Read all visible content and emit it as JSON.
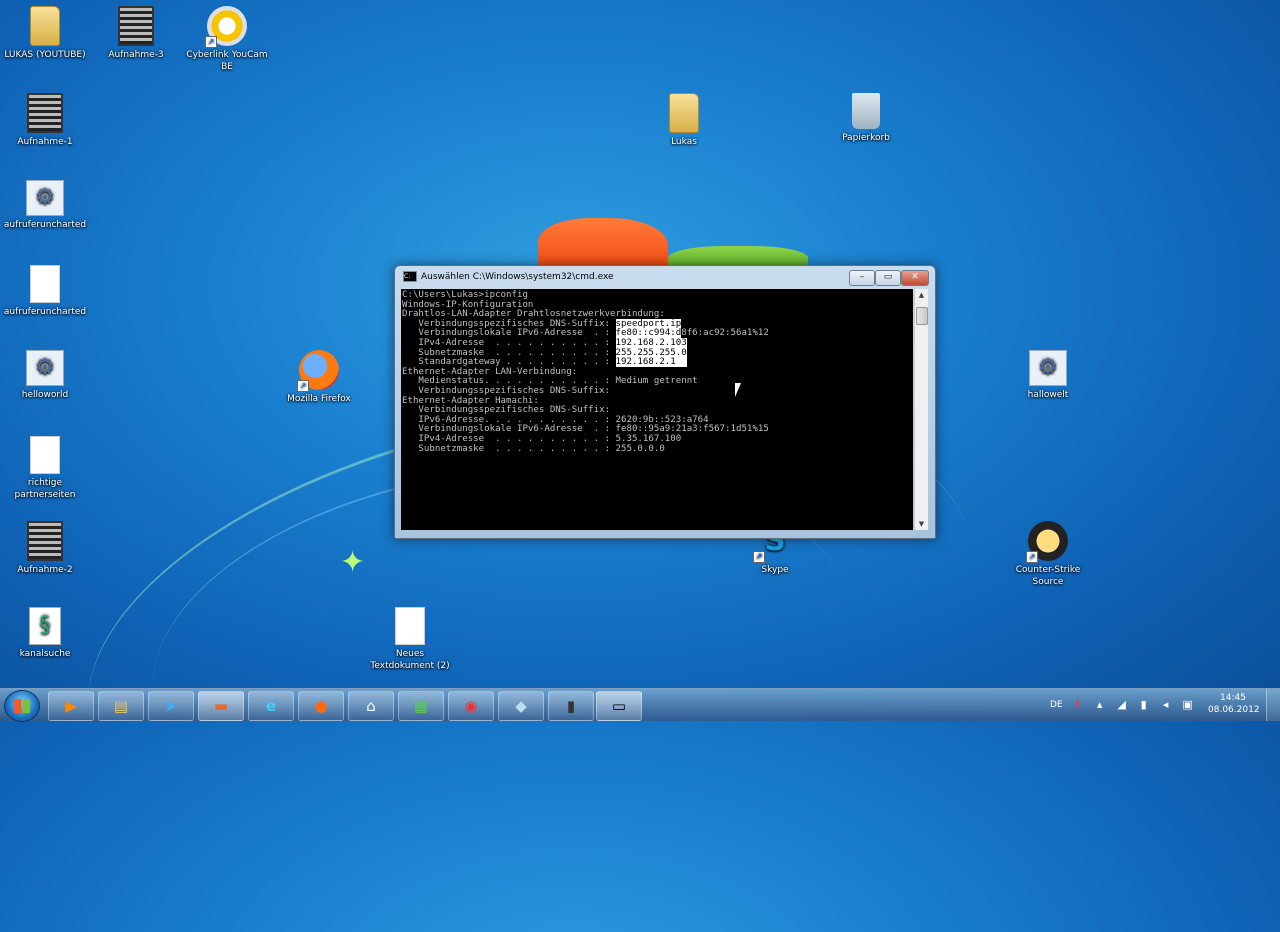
{
  "desktop": {
    "icons": [
      {
        "key": "lukas_youtube",
        "label": "LUKAS (YOUTUBE)",
        "icon": "folder-icon"
      },
      {
        "key": "aufnahme3",
        "label": "Aufnahme-3",
        "icon": "video-file-icon"
      },
      {
        "key": "cyberlink",
        "label": "Cyberlink YouCam BE",
        "icon": "webcam-icon"
      },
      {
        "key": "aufnahme1",
        "label": "Aufnahme-1",
        "icon": "video-file-icon"
      },
      {
        "key": "aufruferuncharted1",
        "label": "aufruferuncharted",
        "icon": "batch-file-icon"
      },
      {
        "key": "aufruferuncharted2",
        "label": "aufruferuncharted",
        "icon": "text-file-icon"
      },
      {
        "key": "helloworld",
        "label": "helloworld",
        "icon": "batch-file-icon"
      },
      {
        "key": "richtige",
        "label": "richtige partnerseiten",
        "icon": "text-file-icon"
      },
      {
        "key": "aufnahme2",
        "label": "Aufnahme-2",
        "icon": "video-file-icon"
      },
      {
        "key": "kanalsuche",
        "label": "kanalsuche",
        "icon": "script-file-icon"
      },
      {
        "key": "firefox",
        "label": "Mozilla Firefox",
        "icon": "firefox-icon"
      },
      {
        "key": "neues",
        "label": "Neues Textdokument (2)",
        "icon": "text-file-icon"
      },
      {
        "key": "lukas",
        "label": "Lukas",
        "icon": "folder-icon"
      },
      {
        "key": "papierkorb",
        "label": "Papierkorb",
        "icon": "recycle-bin-icon"
      },
      {
        "key": "skype",
        "label": "Skype",
        "icon": "skype-icon"
      },
      {
        "key": "hallowelt",
        "label": "hallowelt",
        "icon": "batch-file-icon"
      },
      {
        "key": "counterstrike",
        "label": "Counter-Strike Source",
        "icon": "counter-strike-icon"
      }
    ]
  },
  "cmd": {
    "title": "Auswählen C:\\Windows\\system32\\cmd.exe",
    "buttons": {
      "minimize": "–",
      "maximize": "▭",
      "close": "✕"
    },
    "lines": [
      "C:\\Users\\Lukas>ipconfig",
      "",
      "Windows-IP-Konfiguration",
      "",
      "",
      "Drahtlos-LAN-Adapter Drahtlosnetzwerkverbindung:",
      "",
      "   Verbindungsspezifisches DNS-Suffix: ",
      "   Verbindungslokale IPv6-Adresse  . : ",
      "   IPv4-Adresse  . . . . . . . . . . : ",
      "   Subnetzmaske  . . . . . . . . . . : ",
      "   Standardgateway . . . . . . . . . : ",
      "",
      "Ethernet-Adapter LAN-Verbindung:",
      "",
      "   Medienstatus. . . . . . . . . . . : Medium getrennt",
      "   Verbindungsspezifisches DNS-Suffix:",
      "",
      "Ethernet-Adapter Hamachi:",
      "",
      "   Verbindungsspezifisches DNS-Suffix:",
      "   IPv6-Adresse. . . . . . . . . . . : 2620:9b::523:a764",
      "   Verbindungslokale IPv6-Adresse  . : fe80::95a9:21a3:f567:1d51%15",
      "   IPv4-Adresse  . . . . . . . . . . : 5.35.167.100",
      "   Subnetzmaske  . . . . . . . . . . : 255.0.0.0"
    ],
    "selected": {
      "dns_suffix": "speedport.ip",
      "ipv6_sel": "fe80::c994:d",
      "ipv6_rest": "8f6:ac92:56a1%12",
      "ipv4": "192.168.2.103",
      "subnet": "255.255.255.0",
      "gateway": "192.168.2.1  "
    }
  },
  "taskbar": {
    "buttons": [
      {
        "key": "media",
        "icon": "media-player-icon",
        "glyph": "▶"
      },
      {
        "key": "explorer",
        "icon": "folder-icon",
        "glyph": "▤"
      },
      {
        "key": "app3",
        "icon": "arrow-app-icon",
        "glyph": "➤"
      },
      {
        "key": "app4",
        "icon": "app-icon",
        "glyph": "▬"
      },
      {
        "key": "ie",
        "icon": "internet-explorer-icon",
        "glyph": "e"
      },
      {
        "key": "firefox",
        "icon": "firefox-icon",
        "glyph": "●"
      },
      {
        "key": "hp",
        "icon": "hp-icon",
        "glyph": "⌂"
      },
      {
        "key": "notepad",
        "icon": "notepad-icon",
        "glyph": "▦"
      },
      {
        "key": "chrome",
        "icon": "chrome-icon",
        "glyph": "◉"
      },
      {
        "key": "app10",
        "icon": "app-icon",
        "glyph": "◆"
      },
      {
        "key": "app11",
        "icon": "app-icon",
        "glyph": "▮"
      },
      {
        "key": "cmd",
        "icon": "cmd-icon",
        "glyph": "▭"
      }
    ],
    "lang": "DE",
    "time": "14:45",
    "date": "08.06.2012"
  }
}
